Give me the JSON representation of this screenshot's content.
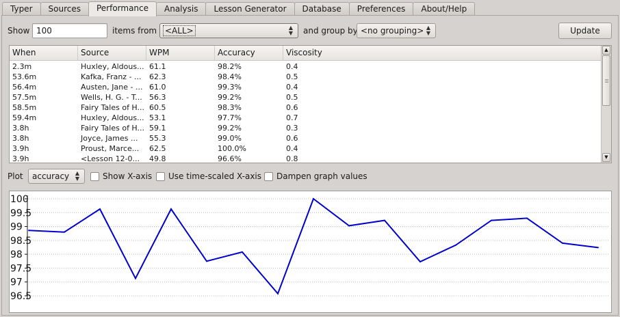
{
  "tabs": [
    "Typer",
    "Sources",
    "Performance",
    "Analysis",
    "Lesson Generator",
    "Database",
    "Preferences",
    "About/Help"
  ],
  "active_tab": "Performance",
  "filter": {
    "show_label": "Show",
    "show_value": "100",
    "items_from_label": "items from",
    "items_from_value": "<ALL>",
    "group_by_label": "and group by",
    "group_by_value": "<no grouping>",
    "update_label": "Update"
  },
  "table": {
    "columns": [
      "When",
      "Source",
      "WPM",
      "Accuracy",
      "Viscosity"
    ],
    "rows": [
      [
        "2.3m",
        "Huxley, Aldous...",
        "61.1",
        "98.2%",
        "0.4"
      ],
      [
        "53.6m",
        "Kafka, Franz - ...",
        "62.3",
        "98.4%",
        "0.5"
      ],
      [
        "56.4m",
        "Austen, Jane - ...",
        "61.0",
        "99.3%",
        "0.4"
      ],
      [
        "57.5m",
        "Wells, H. G. - T...",
        "56.3",
        "99.2%",
        "0.5"
      ],
      [
        "58.5m",
        "Fairy Tales of H...",
        "60.5",
        "98.3%",
        "0.6"
      ],
      [
        "59.4m",
        "Huxley, Aldous...",
        "53.1",
        "97.7%",
        "0.7"
      ],
      [
        "3.8h",
        "Fairy Tales of H...",
        "59.1",
        "99.2%",
        "0.3"
      ],
      [
        "3.8h",
        "Joyce, James ...",
        "55.3",
        "99.0%",
        "0.6"
      ],
      [
        "3.9h",
        "Proust, Marce...",
        "62.5",
        "100.0%",
        "0.4"
      ],
      [
        "3.9h",
        "<Lesson 12-0...",
        "49.8",
        "96.6%",
        "0.8"
      ]
    ]
  },
  "plot_controls": {
    "plot_label": "Plot",
    "plot_value": "accuracy",
    "show_x_axis": "Show X-axis",
    "time_scaled": "Use time-scaled X-axis",
    "dampen": "Dampen graph values"
  },
  "chart_data": {
    "type": "line",
    "title": "",
    "xlabel": "",
    "ylabel": "",
    "ylim": [
      96.5,
      100
    ],
    "yticks": [
      "100",
      "99.5",
      "99",
      "98.5",
      "98",
      "97.5",
      "97",
      "96.5"
    ],
    "grid": "horizontal dotted",
    "line_color": "#0000cc",
    "series": [
      {
        "values": [
          98.86,
          98.8,
          99.63,
          97.13,
          99.63,
          97.75,
          98.08,
          96.58,
          100.0,
          99.03,
          99.22,
          97.73,
          98.33,
          99.22,
          99.3,
          98.4,
          98.24
        ]
      }
    ]
  }
}
